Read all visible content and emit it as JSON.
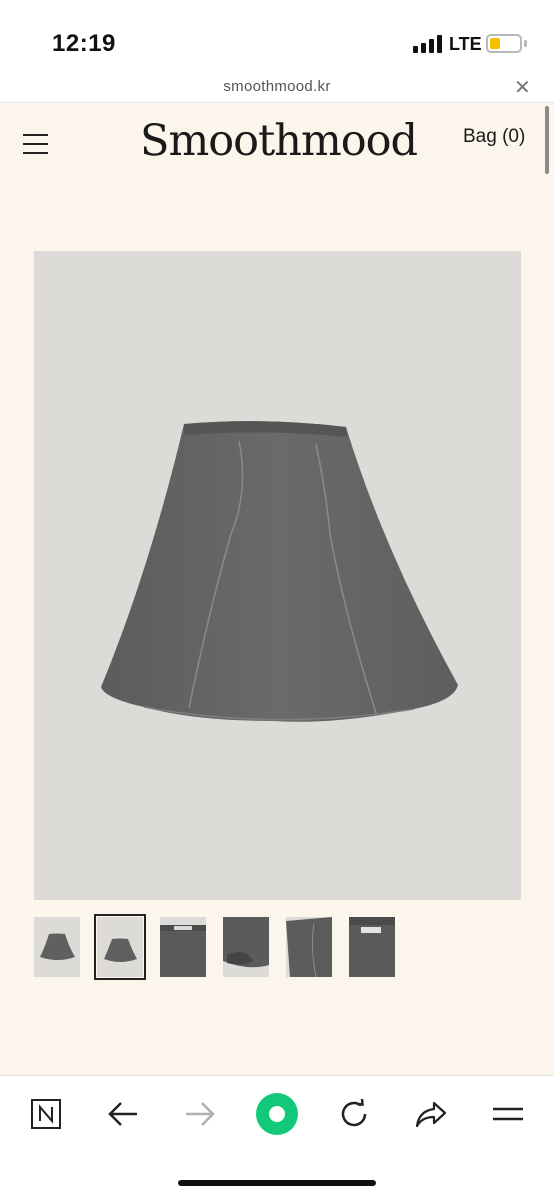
{
  "status_bar": {
    "time": "12:19",
    "network": "LTE",
    "battery_level": 0.35,
    "battery_color": "#f2c200"
  },
  "browser": {
    "url": "smoothmood.kr",
    "close_icon": "close-icon"
  },
  "header": {
    "menu_icon": "hamburger-menu-icon",
    "logo": "Smoothmood",
    "bag_label": "Bag (0)"
  },
  "product": {
    "main_image": "grey-a-line-skirt-photo",
    "thumbnails": [
      {
        "name": "skirt-front-thumbnail",
        "selected": false
      },
      {
        "name": "skirt-front-alt-thumbnail",
        "selected": true
      },
      {
        "name": "skirt-waistband-detail-thumbnail",
        "selected": false
      },
      {
        "name": "skirt-hem-detail-thumbnail",
        "selected": false
      },
      {
        "name": "skirt-seam-detail-thumbnail",
        "selected": false
      },
      {
        "name": "skirt-label-detail-thumbnail",
        "selected": false
      }
    ]
  },
  "toolbar": {
    "items": [
      "naver-home-icon",
      "back-arrow-icon",
      "forward-arrow-icon",
      "green-circle-icon",
      "refresh-icon",
      "share-icon",
      "menu-icon"
    ],
    "accent": "#12c97a"
  },
  "colors": {
    "page_background": "#fbf5ec",
    "image_background": "#dcdbd8",
    "skirt": "#656565"
  }
}
